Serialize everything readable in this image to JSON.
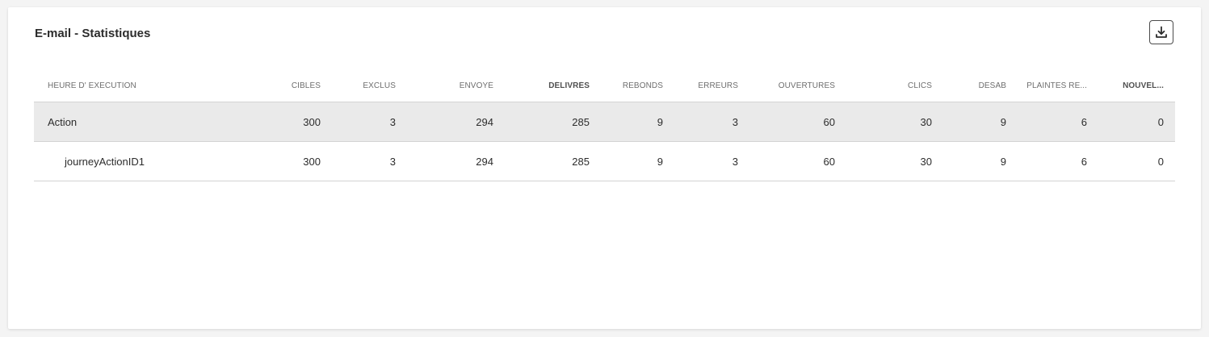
{
  "card": {
    "title": "E-mail - Statistiques",
    "download_icon": "download-icon"
  },
  "table": {
    "columns": [
      "HEURE D' EXECUTION",
      "CIBLÉS",
      "EXCLUS",
      "ENVOYÉ",
      "DÉLIVRÉS",
      "REBONDS",
      "ERREURS",
      "OUVERTURES",
      "CLICS",
      "DÉSAB",
      "PLAINTES RE...",
      "NOUVEL..."
    ],
    "rows": [
      {
        "name": "Action",
        "values": [
          "300",
          "3",
          "294",
          "285",
          "9",
          "3",
          "60",
          "30",
          "9",
          "6",
          "0"
        ]
      },
      {
        "name": "journeyActionID1",
        "values": [
          "300",
          "3",
          "294",
          "285",
          "9",
          "3",
          "60",
          "30",
          "9",
          "6",
          "0"
        ]
      }
    ]
  },
  "colors": {
    "selected_row": "#eaeaea",
    "border": "#d3d3d3",
    "text": "#2c2c2c",
    "header_text": "#6e6e6e"
  }
}
